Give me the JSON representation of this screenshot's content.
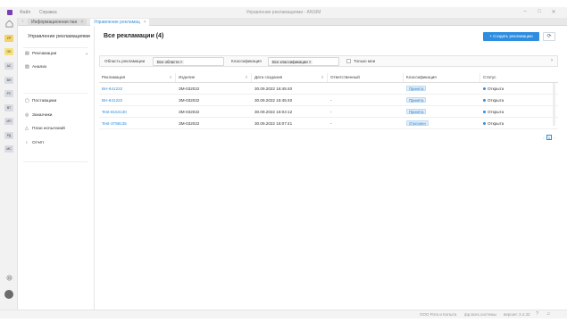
{
  "titlebar": {
    "menu": [
      "Файл",
      "Справка"
    ],
    "title": "Управление рекламациями - ANSIM",
    "controls": [
      "minimize-icon",
      "maximize-icon",
      "close-icon"
    ]
  },
  "rail": {
    "badges": [
      {
        "text": "УР",
        "color": "#f3d36b"
      },
      {
        "text": "ОБ",
        "color": "#f7e27a"
      },
      {
        "text": "АС",
        "color": "#d9dce3"
      },
      {
        "text": "ВН",
        "color": "#d9dce3"
      },
      {
        "text": "РС",
        "color": "#d9dce3"
      },
      {
        "text": "ВТ",
        "color": "#d9dce3"
      },
      {
        "text": "ИП",
        "color": "#d9dce3"
      },
      {
        "text": "РД",
        "color": "#d9dce3"
      },
      {
        "text": "МС",
        "color": "#d9dce3"
      }
    ]
  },
  "tabs": [
    {
      "label": "Информационная пан",
      "active": false
    },
    {
      "label": "Управление рекламац",
      "active": true
    }
  ],
  "sidenav": {
    "title": "Управление рекламациями",
    "items": [
      {
        "label": "Рекламации",
        "icon": "list-icon"
      },
      {
        "label": "Анализ",
        "icon": "chart-icon"
      },
      {
        "label": "Поставщики",
        "icon": "supplier-icon"
      },
      {
        "label": "Заказчики",
        "icon": "customer-icon"
      },
      {
        "label": "План испытаний",
        "icon": "test-plan-icon"
      },
      {
        "label": "Отчёт",
        "icon": "report-icon"
      }
    ]
  },
  "main": {
    "title": "Все рекламации (4)",
    "create_label": "Создать рекламацию",
    "create_icon": "plus-icon",
    "refresh_icon": "refresh-icon"
  },
  "filters": {
    "area_label": "Область рекламации",
    "area_chip": "Все области",
    "class_label": "Классификация",
    "class_chip": "Все классификации",
    "only_mine_label": "Только мои"
  },
  "table": {
    "columns": [
      "Рекламация",
      "Изделие",
      "Дата создания",
      "Ответственный",
      "Классификация",
      "Статус"
    ],
    "rows": [
      {
        "id": "ВН-641222",
        "product": "ЗМ-032022",
        "date": "30.09.2022 16:45:40",
        "owner": "",
        "class": "Принята",
        "status": "Открыта"
      },
      {
        "id": "ВН-641222",
        "product": "ЗМ-032022",
        "date": "30.09.2022 16:45:40",
        "owner": "-",
        "class": "Принята",
        "status": "Открыта"
      },
      {
        "id": "Test-8154130",
        "product": "ЗМ-032022",
        "date": "30.09.2022 16:04:12",
        "owner": "-",
        "class": "Принята",
        "status": "Открыта"
      },
      {
        "id": "Test-3798135",
        "product": "ЗМ-032022",
        "date": "30.09.2022 16:07:41",
        "owner": "-",
        "class": "Отклонен",
        "status": "Открыта"
      }
    ],
    "status_color": "#2e8de0"
  },
  "pager": {
    "current": "1"
  },
  "footer": {
    "company": "ООО Рога и Копыта",
    "user": "фр.всех.системы",
    "version": "версия: 3.4.32"
  },
  "colors": {
    "accent": "#2e8de0",
    "brand": "#7a3fb0"
  }
}
